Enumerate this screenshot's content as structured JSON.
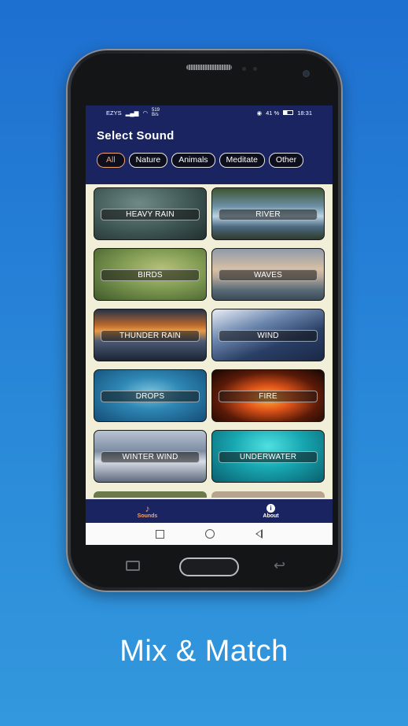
{
  "status_bar": {
    "carrier": "EZYS",
    "net_speed": "519\nB/s",
    "battery": "41 %",
    "time": "18:31"
  },
  "app": {
    "title": "Select Sound",
    "chips": [
      "All",
      "Nature",
      "Animals",
      "Meditate",
      "Other"
    ],
    "active_chip": "All",
    "sounds": [
      "HEAVY RAIN",
      "RIVER",
      "BIRDS",
      "WAVES",
      "THUNDER RAIN",
      "WIND",
      "DROPS",
      "FIRE",
      "WINTER WIND",
      "UNDERWATER"
    ],
    "nav": {
      "sounds_label": "Sounds",
      "about_label": "About"
    }
  },
  "colors": {
    "primary": "#1a2460",
    "accent": "#f3a46f",
    "background": "#f2efd9"
  },
  "tagline": "Mix & Match"
}
